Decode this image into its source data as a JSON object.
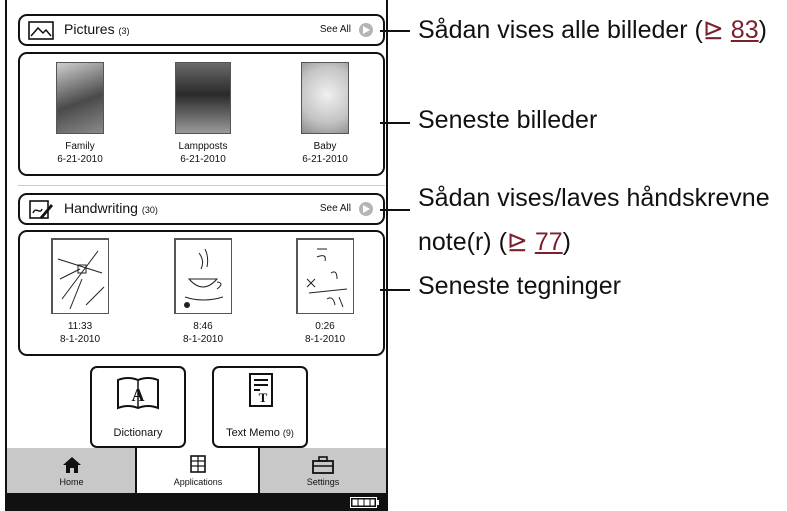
{
  "pictures": {
    "title": "Pictures",
    "count": "(3)",
    "see_all": "See All",
    "items": [
      {
        "name": "Family",
        "date": "6-21-2010"
      },
      {
        "name": "Lampposts",
        "date": "6-21-2010"
      },
      {
        "name": "Baby",
        "date": "6-21-2010"
      }
    ]
  },
  "handwriting": {
    "title": "Handwriting",
    "count": "(30)",
    "see_all": "See All",
    "items": [
      {
        "time": "11:33",
        "date": "8-1-2010"
      },
      {
        "time": "8:46",
        "date": "8-1-2010"
      },
      {
        "time": "0:26",
        "date": "8-1-2010"
      }
    ]
  },
  "apps": {
    "dictionary": "Dictionary",
    "text_memo": "Text Memo",
    "text_memo_count": "(9)"
  },
  "nav": {
    "home": "Home",
    "applications": "Applications",
    "settings": "Settings"
  },
  "callouts": {
    "show_all_pictures": "Sådan vises alle billeder (",
    "show_all_pictures_ref": "83",
    "recent_pictures": "Seneste billeder",
    "show_handwriting_line1": "Sådan vises/laves håndskrevne",
    "show_handwriting_line2": "note(r) (",
    "show_handwriting_ref": "77",
    "recent_drawings": "Seneste tegninger",
    "ref_arrow_glyph": "⊵",
    "close_paren": ")"
  }
}
